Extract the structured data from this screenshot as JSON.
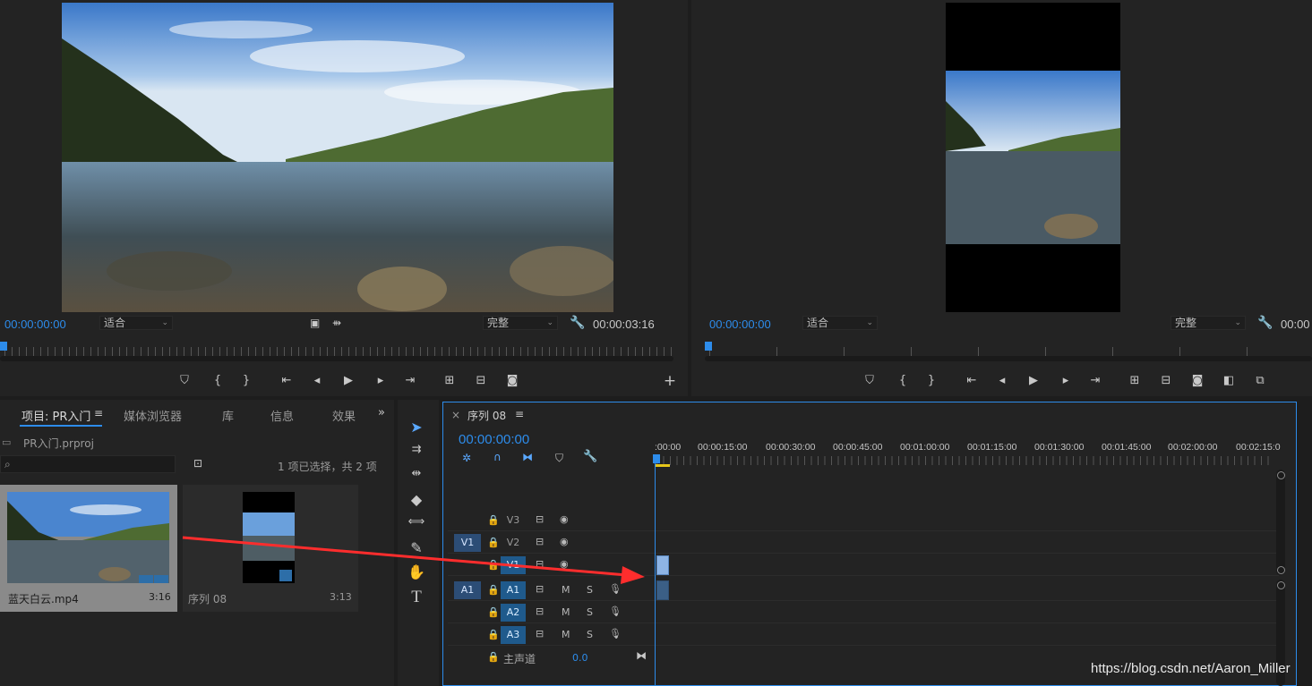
{
  "source_monitor": {
    "timecode_in": "00:00:00:00",
    "zoom": "适合",
    "quality": "完整",
    "duration": "00:00:03:16"
  },
  "program_monitor": {
    "timecode": "00:00:00:00",
    "zoom": "适合",
    "quality": "完整",
    "duration_partial": "00:00"
  },
  "project_panel": {
    "tabs": [
      "项目: PR入门",
      "媒体浏览器",
      "库",
      "信息",
      "效果"
    ],
    "more": "»",
    "file": "PR入门.prproj",
    "search_placeholder": "",
    "selection_status": "1 项已选择，共 2 项",
    "items": [
      {
        "name": "蓝天白云.mp4",
        "duration": "3:16"
      },
      {
        "name": "序列 08",
        "duration": "3:13"
      }
    ]
  },
  "timeline": {
    "tab_label": "序列 08",
    "close": "×",
    "menu": "≡",
    "timecode": "00:00:00:00",
    "ruler_labels": [
      ":00:00",
      "00:00:15:00",
      "00:00:30:00",
      "00:00:45:00",
      "00:01:00:00",
      "00:01:15:00",
      "00:01:30:00",
      "00:01:45:00",
      "00:02:00:00",
      "00:02:15:0"
    ],
    "video_tracks": [
      {
        "label": "V3",
        "source": ""
      },
      {
        "label": "V2",
        "source": "V1"
      },
      {
        "label": "V1",
        "source": ""
      }
    ],
    "audio_tracks": [
      {
        "label": "A1",
        "source": "A1",
        "m": "M",
        "s": "S"
      },
      {
        "label": "A2",
        "source": "",
        "m": "M",
        "s": "S"
      },
      {
        "label": "A3",
        "source": "",
        "m": "M",
        "s": "S"
      }
    ],
    "master_label": "主声道",
    "master_value": "0.0"
  },
  "watermark": "https://blog.csdn.net/Aaron_Miller",
  "colors": {
    "accent": "#2d8ceb",
    "arrow": "#ff2d2d",
    "track_on": "#1f5a8c"
  }
}
